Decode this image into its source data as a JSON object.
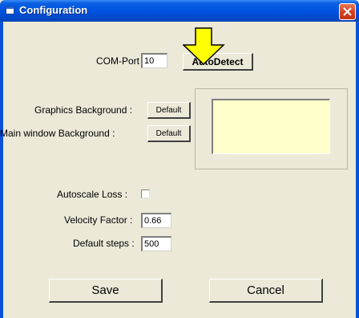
{
  "window": {
    "title": "Configuration",
    "icon": "window-app-icon",
    "close_icon": "close-icon"
  },
  "com_port": {
    "label": "COM-Port",
    "value": "10",
    "autodetect_label": "AutoDetect"
  },
  "graphics_background": {
    "label": "Graphics Background :",
    "button_label": "Default"
  },
  "main_window_background": {
    "label": "Main window Background :",
    "button_label": "Default"
  },
  "preview": {
    "color": "#ffffcc"
  },
  "autoscale_loss": {
    "label": "Autoscale Loss :",
    "checked": false
  },
  "velocity_factor": {
    "label": "Velocity Factor :",
    "value": "0.66"
  },
  "default_steps": {
    "label": "Default steps :",
    "value": "500"
  },
  "buttons": {
    "save_label": "Save",
    "cancel_label": "Cancel"
  },
  "annotation": {
    "icon": "arrow-down-icon",
    "color": "#ffff00"
  }
}
